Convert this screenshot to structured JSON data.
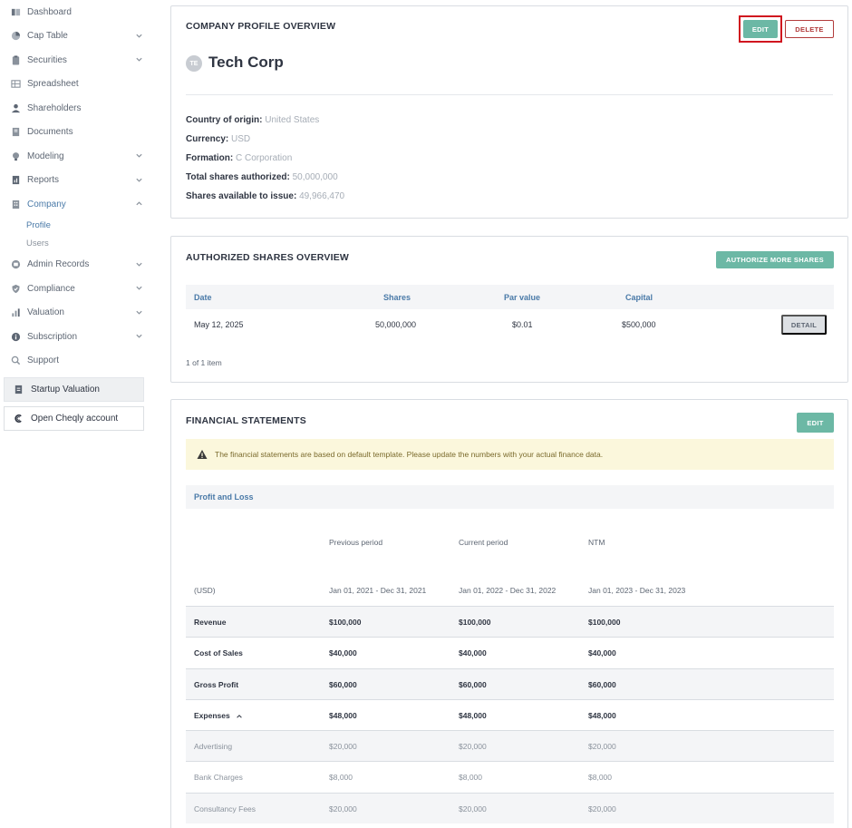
{
  "sidebar": {
    "items": [
      {
        "label": "Dashboard",
        "icon": "dashboard-icon",
        "has_chevron": false
      },
      {
        "label": "Cap Table",
        "icon": "pie-chart-icon",
        "has_chevron": true
      },
      {
        "label": "Securities",
        "icon": "clipboard-icon",
        "has_chevron": true
      },
      {
        "label": "Spreadsheet",
        "icon": "spreadsheet-icon",
        "has_chevron": false
      },
      {
        "label": "Shareholders",
        "icon": "person-icon",
        "has_chevron": false
      },
      {
        "label": "Documents",
        "icon": "document-icon",
        "has_chevron": false
      },
      {
        "label": "Modeling",
        "icon": "bulb-icon",
        "has_chevron": true
      },
      {
        "label": "Reports",
        "icon": "report-icon",
        "has_chevron": true
      },
      {
        "label": "Company",
        "icon": "building-icon",
        "has_chevron": true,
        "expanded": true
      }
    ],
    "company_sub": [
      {
        "label": "Profile",
        "active": true
      },
      {
        "label": "Users",
        "active": false
      }
    ],
    "items_after": [
      {
        "label": "Admin Records",
        "icon": "records-icon",
        "has_chevron": true
      },
      {
        "label": "Compliance",
        "icon": "shield-icon",
        "has_chevron": true
      },
      {
        "label": "Valuation",
        "icon": "scale-icon",
        "has_chevron": true
      },
      {
        "label": "Subscription",
        "icon": "info-icon",
        "has_chevron": true
      },
      {
        "label": "Support",
        "icon": "support-icon",
        "has_chevron": false
      }
    ],
    "startup_valuation": "Startup Valuation",
    "open_cheqly": "Open Cheqly account"
  },
  "profile": {
    "title": "COMPANY PROFILE OVERVIEW",
    "edit_label": "EDIT",
    "delete_label": "DELETE",
    "avatar_initials": "TE",
    "company_name": "Tech Corp",
    "fields": [
      {
        "key": "Country of origin:",
        "value": "United States"
      },
      {
        "key": "Currency:",
        "value": "USD"
      },
      {
        "key": "Formation:",
        "value": "C Corporation"
      },
      {
        "key": "Total shares authorized:",
        "value": "50,000,000"
      },
      {
        "key": "Shares available to issue:",
        "value": "49,966,470"
      }
    ]
  },
  "authorized": {
    "title": "AUTHORIZED SHARES OVERVIEW",
    "authorize_label": "AUTHORIZE MORE SHARES",
    "columns": [
      "Date",
      "Shares",
      "Par value",
      "Capital"
    ],
    "rows": [
      {
        "date": "May 12, 2025",
        "shares": "50,000,000",
        "par": "$0.01",
        "capital": "$500,000",
        "action": "DETAIL"
      }
    ],
    "pager": "1 of 1 item"
  },
  "financial": {
    "title": "FINANCIAL STATEMENTS",
    "edit_label": "EDIT",
    "alert": "The financial statements are based on default template. Please update the numbers with your actual finance data.",
    "section": "Profit and Loss",
    "periods": [
      "Previous period",
      "Current period",
      "NTM"
    ],
    "currency": "(USD)",
    "ranges": [
      "Jan 01, 2021 - Dec 31, 2021",
      "Jan 01, 2022 - Dec 31, 2022",
      "Jan 01, 2023 - Dec 31, 2023"
    ],
    "rows": [
      {
        "label": "Revenue",
        "values": [
          "$100,000",
          "$100,000",
          "$100,000"
        ],
        "style": "bold"
      },
      {
        "label": "Cost of Sales",
        "values": [
          "$40,000",
          "$40,000",
          "$40,000"
        ],
        "style": "bold-white"
      },
      {
        "label": "Gross Profit",
        "values": [
          "$60,000",
          "$60,000",
          "$60,000"
        ],
        "style": "bold"
      },
      {
        "label": "Expenses",
        "values": [
          "$48,000",
          "$48,000",
          "$48,000"
        ],
        "style": "bold-white",
        "expandable": true
      },
      {
        "label": "Advertising",
        "values": [
          "$20,000",
          "$20,000",
          "$20,000"
        ],
        "style": "sub-alt"
      },
      {
        "label": "Bank Charges",
        "values": [
          "$8,000",
          "$8,000",
          "$8,000"
        ],
        "style": "sub"
      },
      {
        "label": "Consultancy Fees",
        "values": [
          "$20,000",
          "$20,000",
          "$20,000"
        ],
        "style": "sub-alt"
      }
    ]
  },
  "colors": {
    "teal": "#6cb8a5",
    "red": "#b23b3b",
    "highlight": "#d0161f",
    "link_blue": "#4a7aa8"
  }
}
